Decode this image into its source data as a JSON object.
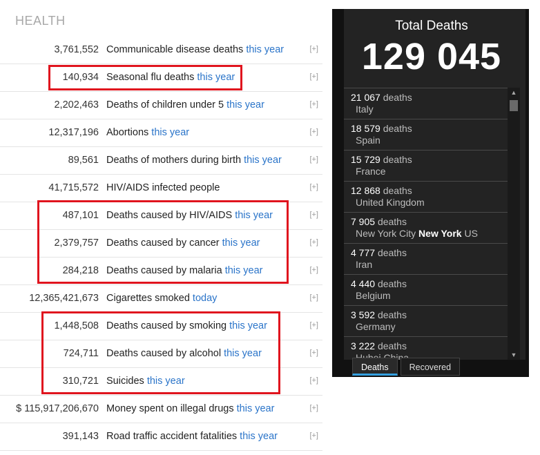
{
  "health": {
    "section_title": "HEALTH",
    "rows": [
      {
        "value": "3,761,552",
        "label": "Communicable disease deaths",
        "period": "this year",
        "expand": "[+]"
      },
      {
        "value": "140,934",
        "label": "Seasonal flu deaths",
        "period": "this year",
        "expand": "[+]"
      },
      {
        "value": "2,202,463",
        "label": "Deaths of children under 5",
        "period": "this year",
        "expand": "[+]"
      },
      {
        "value": "12,317,196",
        "label": "Abortions",
        "period": "this year",
        "expand": "[+]"
      },
      {
        "value": "89,561",
        "label": "Deaths of mothers during birth",
        "period": "this year",
        "expand": "[+]"
      },
      {
        "value": "41,715,572",
        "label": "HIV/AIDS infected people",
        "period": "",
        "expand": "[+]"
      },
      {
        "value": "487,101",
        "label": "Deaths caused by HIV/AIDS",
        "period": "this year",
        "expand": "[+]"
      },
      {
        "value": "2,379,757",
        "label": "Deaths caused by cancer",
        "period": "this year",
        "expand": "[+]"
      },
      {
        "value": "284,218",
        "label": "Deaths caused by malaria",
        "period": "this year",
        "expand": "[+]"
      },
      {
        "value": "12,365,421,673",
        "label": "Cigarettes smoked",
        "period": "today",
        "expand": "[+]"
      },
      {
        "value": "1,448,508",
        "label": "Deaths caused by smoking",
        "period": "this year",
        "expand": "[+]"
      },
      {
        "value": "724,711",
        "label": "Deaths caused by alcohol",
        "period": "this year",
        "expand": "[+]"
      },
      {
        "value": "310,721",
        "label": "Suicides",
        "period": "this year",
        "expand": "[+]"
      },
      {
        "value": "$ 115,917,206,670",
        "label": "Money spent on illegal drugs",
        "period": "this year",
        "expand": "[+]"
      },
      {
        "value": "391,143",
        "label": "Road traffic accident fatalities",
        "period": "this year",
        "expand": "[+]"
      }
    ]
  },
  "widget": {
    "title": "Total Deaths",
    "total": "129 045",
    "items": [
      {
        "count": "21 067",
        "unit": "deaths",
        "location": "Italy",
        "city": "",
        "country": ""
      },
      {
        "count": "18 579",
        "unit": "deaths",
        "location": "Spain",
        "city": "",
        "country": ""
      },
      {
        "count": "15 729",
        "unit": "deaths",
        "location": "France",
        "city": "",
        "country": ""
      },
      {
        "count": "12 868",
        "unit": "deaths",
        "location": "United Kingdom",
        "city": "",
        "country": ""
      },
      {
        "count": "7 905",
        "unit": "deaths",
        "location": "New York City",
        "city": "New York",
        "country": "US"
      },
      {
        "count": "4 777",
        "unit": "deaths",
        "location": "Iran",
        "city": "",
        "country": ""
      },
      {
        "count": "4 440",
        "unit": "deaths",
        "location": "Belgium",
        "city": "",
        "country": ""
      },
      {
        "count": "3 592",
        "unit": "deaths",
        "location": "Germany",
        "city": "",
        "country": ""
      },
      {
        "count": "3 222",
        "unit": "deaths",
        "location": "Hubei China",
        "city": "",
        "country": ""
      }
    ],
    "tabs": {
      "deaths": "Deaths",
      "recovered": "Recovered"
    }
  },
  "colors": {
    "highlight": "#e0141e",
    "link": "#2a74c9",
    "widget_bg": "#232323",
    "active_tab": "#35a0e0"
  }
}
